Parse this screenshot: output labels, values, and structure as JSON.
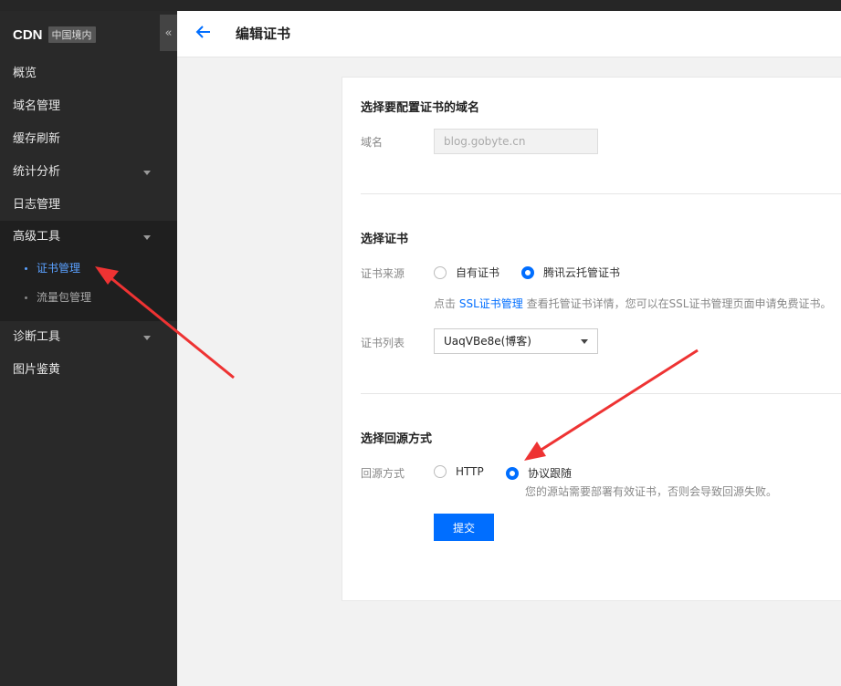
{
  "sidebar": {
    "brand_title": "CDN",
    "brand_badge": "中国境内",
    "collapse_glyph": "«",
    "items": [
      {
        "label": "概览"
      },
      {
        "label": "域名管理"
      },
      {
        "label": "缓存刷新"
      },
      {
        "label": "统计分析"
      },
      {
        "label": "日志管理"
      },
      {
        "label": "高级工具"
      },
      {
        "label": "诊断工具"
      },
      {
        "label": "图片鉴黄"
      }
    ],
    "sub_items": [
      {
        "label": "证书管理",
        "active": true
      },
      {
        "label": "流量包管理",
        "active": false
      }
    ]
  },
  "header": {
    "title": "编辑证书",
    "back_icon": "arrow-left-icon"
  },
  "form": {
    "domain_section": {
      "title": "选择要配置证书的域名",
      "label": "域名",
      "placeholder": "blog.gobyte.cn"
    },
    "cert_section": {
      "title": "选择证书",
      "source_label": "证书来源",
      "source_options": [
        "自有证书",
        "腾讯云托管证书"
      ],
      "source_selected": "腾讯云托管证书",
      "hint_prefix": "点击 ",
      "hint_link": "SSL证书管理",
      "hint_suffix": " 查看托管证书详情，您可以在SSL证书管理页面申请免费证书。",
      "list_label": "证书列表",
      "list_selected": "UaqVBe8e(博客)"
    },
    "origin_section": {
      "title": "选择回源方式",
      "label": "回源方式",
      "options": [
        "HTTP",
        "协议跟随"
      ],
      "selected": "协议跟随",
      "hint": "您的源站需要部署有效证书，否则会导致回源失败。"
    },
    "submit_label": "提交"
  },
  "colors": {
    "accent": "#006eff",
    "sidebar_bg": "#292929",
    "annotation_arrow": "#ee3333"
  }
}
